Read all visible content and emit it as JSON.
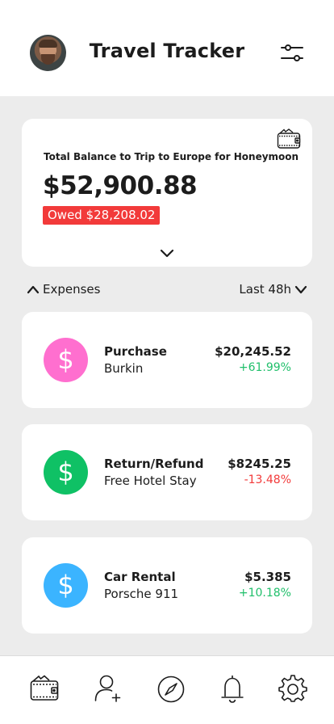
{
  "header": {
    "title": "Travel Tracker"
  },
  "balance": {
    "label": "Total Balance to Trip to Europe for Honeymoon",
    "amount": "$52,900.88",
    "owed": "Owed $28,208.02"
  },
  "section": {
    "title": "Expenses",
    "period": "Last 48h"
  },
  "expenses": [
    {
      "name": "Purchase",
      "sub": "Burkin",
      "amount": "$20,245.52",
      "change": "+61.99%",
      "icon": "dollar-icon",
      "color": "#ff6fcf",
      "change_color": "#1fbf6a"
    },
    {
      "name": "Return/Refund",
      "sub": "Free Hotel Stay",
      "amount": "$8245.25",
      "change": "-13.48%",
      "icon": "dollar-icon",
      "color": "#0fc165",
      "change_color": "#f23a3a"
    },
    {
      "name": "Car Rental",
      "sub": "Porsche 911",
      "amount": "$5.385",
      "change": "+10.18%",
      "icon": "dollar-icon",
      "color": "#3bb4ff",
      "change_color": "#1fbf6a"
    }
  ],
  "icons": {
    "dollar": "$"
  },
  "nav": [
    "wallet-icon",
    "add-user-icon",
    "compass-icon",
    "bell-icon",
    "gear-icon"
  ]
}
